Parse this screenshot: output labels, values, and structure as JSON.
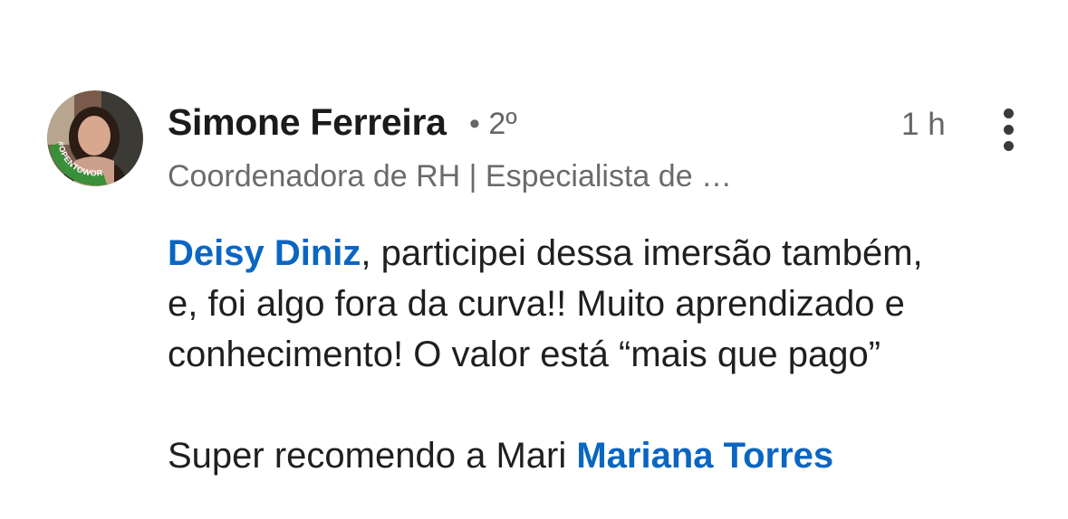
{
  "comment": {
    "author": {
      "name": "Simone Ferreira",
      "degree": "• 2º",
      "headline": "Coordenadora de RH | Especialista de …",
      "avatar_badge_text": "#OPENTOWORK",
      "badge_color": "#3a8f3a"
    },
    "timestamp": "1 h",
    "more_icon": "more-vertical-icon",
    "mention_color": "#0a66c2",
    "paragraph1": {
      "mention": "Deisy Diniz",
      "line1_rest": ", participei dessa imersão também,",
      "line2": "e, foi algo fora da curva!! Muito aprendizado e",
      "line3": "conhecimento! O valor está “mais que pago”"
    },
    "paragraph2": {
      "text": "Super recomendo a Mari ",
      "mention": "Mariana Torres"
    }
  }
}
